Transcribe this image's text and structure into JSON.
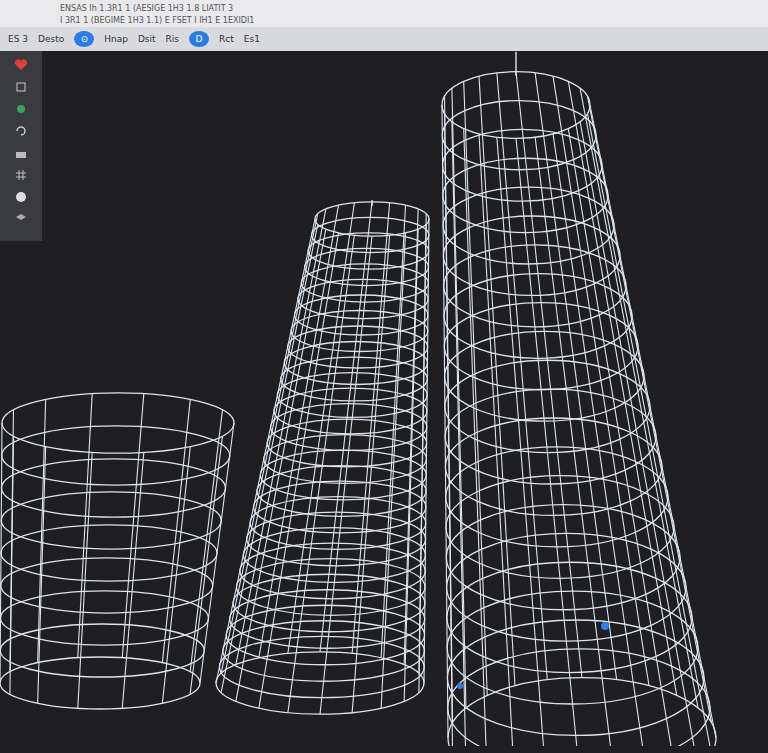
{
  "header": {
    "lines": [
      "ENSAS Ih 1.3R1 1  (AESIGE 1H3 1.8 LIATIT 3",
      "I 3R1 1  (BEGIME 1H3 1.1)  E FSET I IH1 E 1EXIDI1"
    ]
  },
  "toolbar": [
    {
      "label": "ES 3",
      "selected": false
    },
    {
      "label": "Desto",
      "selected": false
    },
    {
      "label": "⊙",
      "selected": true
    },
    {
      "label": "Hnap",
      "selected": false
    },
    {
      "label": "Dsit",
      "selected": false
    },
    {
      "label": "Ris",
      "selected": false
    },
    {
      "label": "D",
      "selected": true
    },
    {
      "label": "Rct",
      "selected": false
    },
    {
      "label": "Es1",
      "selected": false
    }
  ]
}
